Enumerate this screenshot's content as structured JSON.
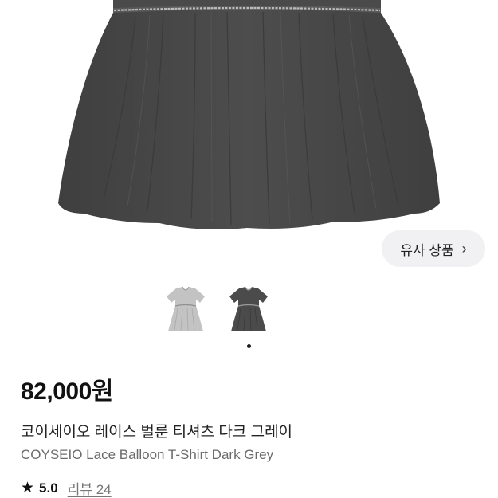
{
  "similar_button": {
    "label": "유사 상품",
    "chevron": "›"
  },
  "thumbnails": [
    {
      "name": "light-grey-variant",
      "color": "#c3c3c3"
    },
    {
      "name": "dark-grey-variant",
      "color": "#4b4b4b"
    }
  ],
  "carousel": {
    "active_index": 1,
    "count": 2
  },
  "product": {
    "price": "82,000원",
    "title_ko": "코이세이오 레이스 벌룬 티셔츠 다크 그레이",
    "title_en": "COYSEIO Lace Balloon T-Shirt Dark Grey",
    "rating": "5.0",
    "reviews": "리뷰 24"
  },
  "colors": {
    "garment": "#4a4a4a",
    "lace": "#b9b9b9",
    "button_bg": "#f1f1f3"
  }
}
